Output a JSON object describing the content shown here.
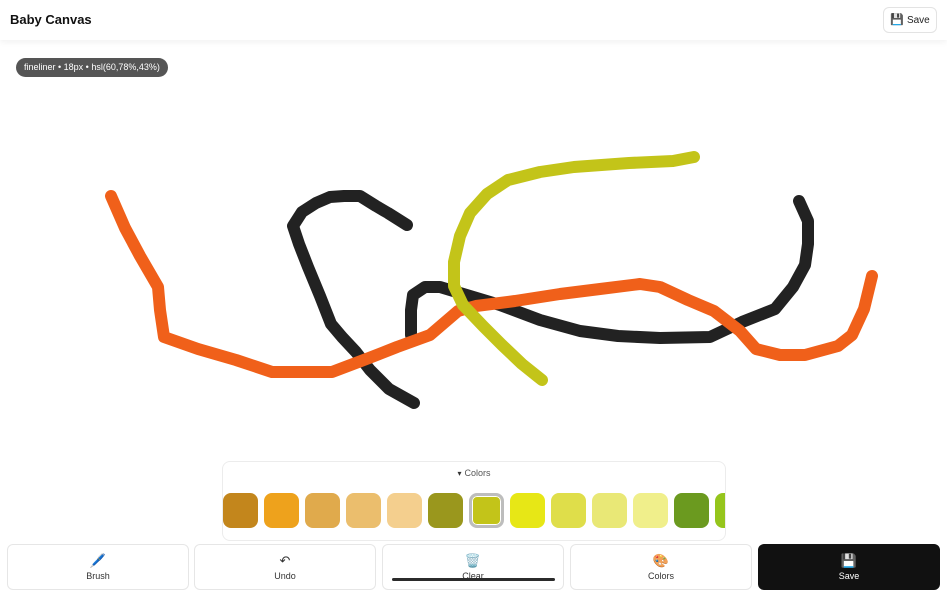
{
  "header": {
    "title": "Baby Canvas",
    "save_icon": "floppy-disk-icon",
    "save_glyph": "💾",
    "save_label": "Save"
  },
  "canvas": {
    "status": "fineliner • 18px • hsl(60,78%,43%)",
    "stroke_colors": [
      "#222222",
      "#f0601a",
      "#c3c419"
    ]
  },
  "colors_panel": {
    "caret": "▾",
    "label": "Colors",
    "swatches": [
      "#c3861c",
      "#eea21c",
      "#e0aa4c",
      "#ebbe6d",
      "#f4cf8e",
      "#9a971d",
      "#c3c419",
      "#e7e716",
      "#dfde4a",
      "#e9e876",
      "#f0ef8b",
      "#6b9a1f",
      "#95c51c"
    ],
    "selected_index": 6
  },
  "toolbar": {
    "brush": {
      "icon": "paintbrush-icon",
      "glyph": "🖊️",
      "label": "Brush"
    },
    "undo": {
      "icon": "undo-icon",
      "glyph": "↶",
      "label": "Undo"
    },
    "clear": {
      "icon": "trash-icon",
      "glyph": "🗑️",
      "label": "Clear"
    },
    "colors": {
      "icon": "palette-icon",
      "glyph": "🎨",
      "label": "Colors"
    },
    "save": {
      "icon": "floppy-disk-icon",
      "glyph": "💾",
      "label": "Save"
    }
  }
}
